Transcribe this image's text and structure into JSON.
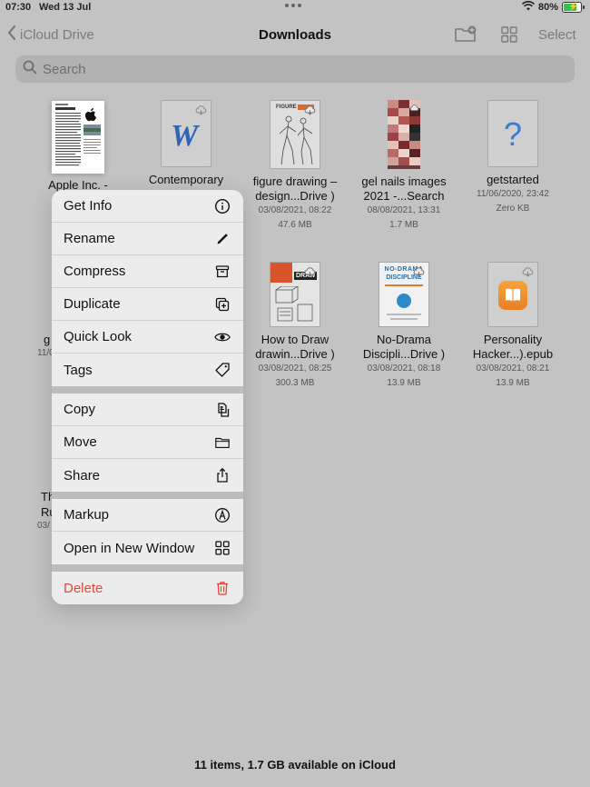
{
  "status": {
    "time": "07:30",
    "date": "Wed 13 Jul",
    "battery": "80%",
    "battery_level": 0.8
  },
  "nav": {
    "back_label": "iCloud Drive",
    "title": "Downloads",
    "select_label": "Select"
  },
  "search": {
    "placeholder": "Search"
  },
  "files": [
    {
      "name1": "Apple Inc. -",
      "name2": "",
      "meta1": "",
      "meta2": ""
    },
    {
      "name1": "Contemporary",
      "name2": "",
      "meta1": "",
      "meta2": "",
      "icon": "word-icon"
    },
    {
      "name1": "figure drawing –",
      "name2": "design...Drive )",
      "meta1": "03/08/2021, 08:22",
      "meta2": "47.6 MB"
    },
    {
      "name1": "gel nails images",
      "name2": "2021 -...Search",
      "meta1": "08/08/2021, 13:31",
      "meta2": "1.7 MB"
    },
    {
      "name1": "getstarted",
      "name2": "",
      "meta1": "11/06/2020, 23:42",
      "meta2": "Zero KB",
      "icon": "question-icon"
    },
    {
      "name1": "How to Draw",
      "name2": "drawin...Drive )",
      "meta1": "03/08/2021, 08:25",
      "meta2": "300.3 MB"
    },
    {
      "name1": "No-Drama",
      "name2": "Discipli...Drive )",
      "meta1": "03/08/2021, 08:18",
      "meta2": "13.9 MB"
    },
    {
      "name1": "Personality",
      "name2": "Hacker...).epub",
      "meta1": "03/08/2021, 08:21",
      "meta2": "13.9 MB",
      "icon": "books-icon"
    }
  ],
  "partial": {
    "g_left": "g",
    "date_left": "11/0",
    "th": "Th",
    "ru": "Ru",
    "date2": "03/"
  },
  "book_covers": {
    "no_drama_l1": "NO-DRAMA",
    "no_drama_l2": "DISCIPLINE",
    "how_to_draw": "DRAW",
    "figure": "FIGURE"
  },
  "menu": {
    "groups": [
      [
        {
          "label": "Get Info",
          "icon": "info-icon"
        },
        {
          "label": "Rename",
          "icon": "pencil-icon"
        },
        {
          "label": "Compress",
          "icon": "archive-box-icon"
        },
        {
          "label": "Duplicate",
          "icon": "duplicate-icon"
        },
        {
          "label": "Quick Look",
          "icon": "eye-icon"
        },
        {
          "label": "Tags",
          "icon": "tag-icon"
        }
      ],
      [
        {
          "label": "Copy",
          "icon": "copy-icon"
        },
        {
          "label": "Move",
          "icon": "folder-icon"
        },
        {
          "label": "Share",
          "icon": "share-icon"
        }
      ],
      [
        {
          "label": "Markup",
          "icon": "markup-icon"
        },
        {
          "label": "Open in New Window",
          "icon": "grid-icon"
        }
      ],
      [
        {
          "label": "Delete",
          "icon": "trash-icon"
        }
      ]
    ]
  },
  "footer": {
    "text": "11 items, 1.7 GB available on iCloud"
  },
  "colors": {
    "danger": "#e0473c",
    "accent_gray": "#7a7a7a",
    "battery_green": "#3bbf4e"
  }
}
